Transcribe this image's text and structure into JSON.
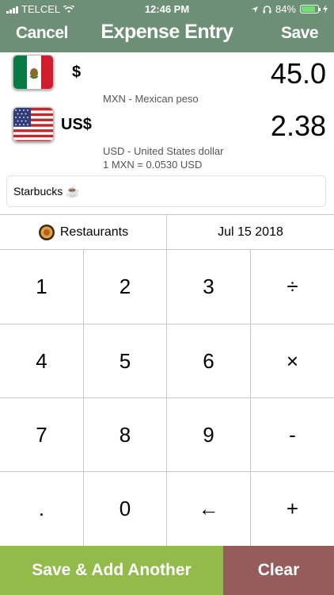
{
  "status_bar": {
    "carrier": "TELCEL",
    "time": "12:46 PM",
    "battery": "84%"
  },
  "nav": {
    "cancel_label": "Cancel",
    "title": "Expense Entry",
    "save_label": "Save"
  },
  "source_currency": {
    "symbol": "$",
    "amount": "45.0",
    "description": "MXN - Mexican peso",
    "flag": "mexico-flag-icon"
  },
  "target_currency": {
    "symbol": "US$",
    "amount": "2.38",
    "description": "USD - United States dollar",
    "rate": "1 MXN = 0.0530 USD",
    "flag": "usa-flag-icon"
  },
  "note": {
    "value": "Starbucks ☕"
  },
  "category": {
    "label": "Restaurants",
    "icon": "restaurant-icon"
  },
  "date": {
    "value": "Jul 15 2018"
  },
  "keypad": {
    "keys": [
      "1",
      "2",
      "3",
      "÷",
      "4",
      "5",
      "6",
      "×",
      "7",
      "8",
      "9",
      "-",
      ".",
      "0",
      "←",
      "+"
    ]
  },
  "actions": {
    "save_add_another": "Save & Add Another",
    "clear": "Clear"
  },
  "colors": {
    "header": "#6d8f76",
    "save_add": "#93bb4c",
    "clear": "#965c5c"
  }
}
